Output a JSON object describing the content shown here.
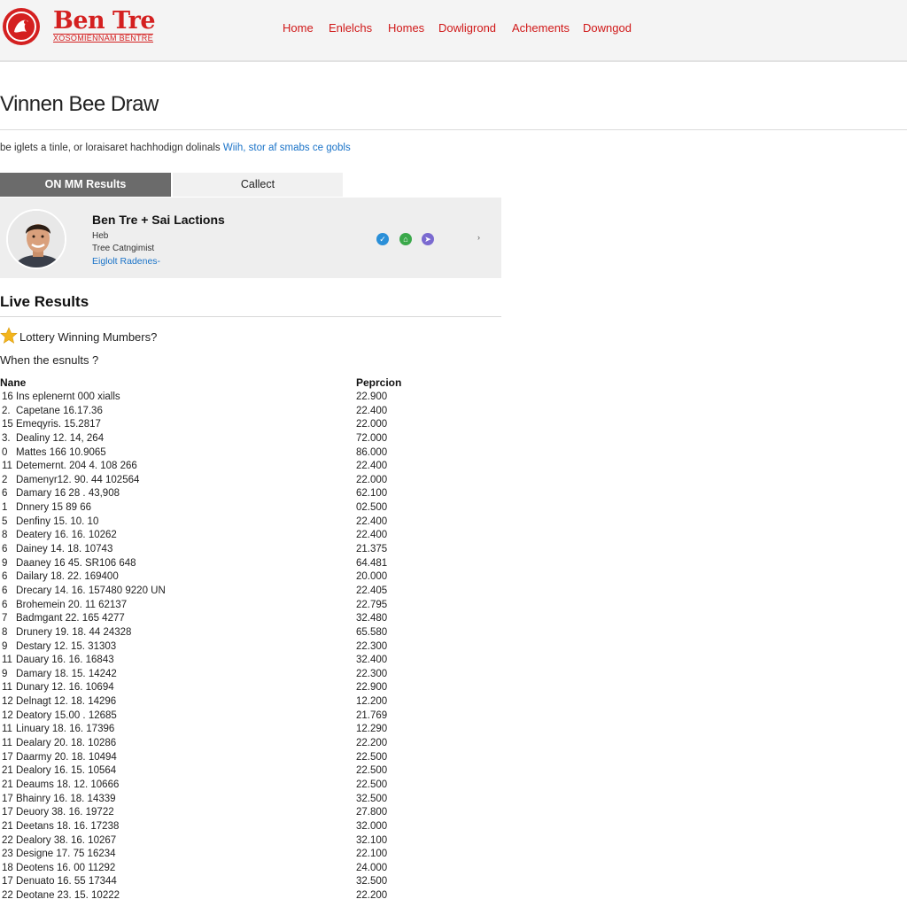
{
  "brand": {
    "name": "Ben Tre",
    "tagline": "XOSOMIENNAM BENTRE"
  },
  "nav": [
    "Home",
    "Enlelchs",
    "Homes",
    "Dowligrond",
    "Achements",
    "Downgod"
  ],
  "page": {
    "title": "Vinnen Bee Draw",
    "intro_text": "be iglets a tinle, or loraisaret hachhodign dolinals",
    "intro_link": "Wiih, stor af smabs ce gobls"
  },
  "tabs": {
    "active": "ON MM Results",
    "other": "Callect"
  },
  "profile": {
    "name": "Ben Tre + Sai Lactions",
    "line1": "Heb",
    "line2": "Tree Catngimist",
    "line3": "Eiglolt Radenes-",
    "more": "›"
  },
  "colors": {
    "brand_red": "#d42020",
    "badge_blue": "#2a8fd8",
    "badge_green": "#3aa84a",
    "badge_purple": "#7a6ad0"
  },
  "live": {
    "title": "Live Results",
    "winning_label": "Lottery Winning Mumbers?",
    "when_label": "When the esnults ?"
  },
  "table": {
    "headers": {
      "name": "Nane",
      "value": "Peprcion"
    },
    "rows": [
      [
        "16",
        "Ins eplenernt 000 xialls",
        "22.900"
      ],
      [
        "2.",
        "Capetane 16.17.36",
        "22.400"
      ],
      [
        "15",
        "Emeqyris. 15.2817",
        "22.000"
      ],
      [
        "3.",
        "Dealiny 12. 14, 264",
        "72.000"
      ],
      [
        "0",
        "Mattes 166 10.9065",
        "86.000"
      ],
      [
        "11",
        "Detemernt. 204 4. 108 266",
        "22.400"
      ],
      [
        "2",
        "Damenyr12. 90. 44 102564",
        "22.000"
      ],
      [
        "6",
        "Damary 16 28 . 43,908",
        "62.100"
      ],
      [
        "1",
        "Dnnery 15 89 66",
        "02.500"
      ],
      [
        "5",
        "Denfiny 15. 10. 10",
        "22.400"
      ],
      [
        "8",
        "Deatery 16. 16. 10262",
        "22.400"
      ],
      [
        "6",
        "Dainey 14. 18. 10743",
        "21.375"
      ],
      [
        "9",
        "Daaney 16 45. SR106 648",
        "64.481"
      ],
      [
        "6",
        "Dailary 18. 22. 169400",
        "20.000"
      ],
      [
        "6",
        "Drecary 14. 16. 157480 9220 UN",
        "22.405"
      ],
      [
        "6",
        "Brohemein 20. 11 62137",
        "22.795"
      ],
      [
        "7",
        "Badmgant 22. 165 4277",
        "32.480"
      ],
      [
        "8",
        "Drunery 19. 18. 44 24328",
        "65.580"
      ],
      [
        "9",
        "Destary 12. 15. 31303",
        "22.300"
      ],
      [
        "11",
        "Dauary 16. 16. 16843",
        "32.400"
      ],
      [
        "9",
        "Damary 18. 15. 14242",
        "22.300"
      ],
      [
        "11",
        "Dunary 12. 16. 10694",
        "22.900"
      ],
      [
        "12",
        "Delnagt 12. 18. 14296",
        "12.200"
      ],
      [
        "12",
        "Deatory 15.00 . 12685",
        "21.769"
      ],
      [
        "11",
        "Linuary 18. 16. 17396",
        "12.290"
      ],
      [
        "11",
        "Dealary 20. 18. 10286",
        "22.200"
      ],
      [
        "17",
        "Daarmy 20. 18. 10494",
        "22.500"
      ],
      [
        "21",
        "Dealory 16. 15. 10564",
        "22.500"
      ],
      [
        "21",
        "Deaums 18. 12. 10666",
        "22.500"
      ],
      [
        "17",
        "Bhainry 16. 18. 14339",
        "32.500"
      ],
      [
        "17",
        "Deuory 38. 16. 19722",
        "27.800"
      ],
      [
        "21",
        "Deetans 18. 16. 17238",
        "32.000"
      ],
      [
        "22",
        "Dealory 38. 16. 10267",
        "32.100"
      ],
      [
        "23",
        "Designe 17. 75 16234",
        "22.100"
      ],
      [
        "18",
        "Deotens 16. 00 11292",
        "24.000"
      ],
      [
        "17",
        "Denuato 16. 55 17344",
        "32.500"
      ],
      [
        "22",
        "Deotane 23. 15. 10222",
        "22.200"
      ]
    ]
  }
}
